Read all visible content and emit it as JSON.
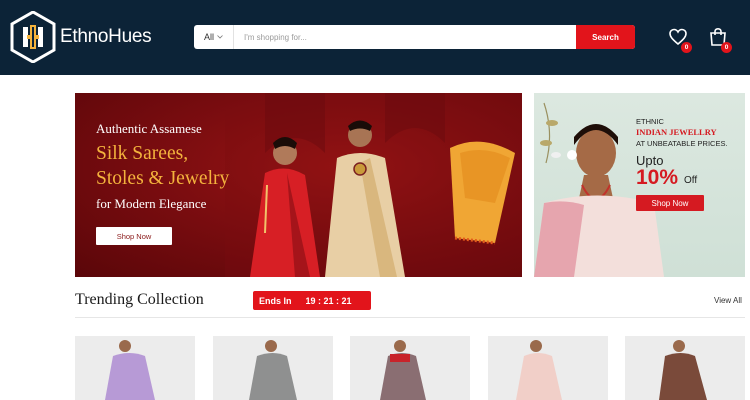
{
  "header": {
    "brand": "EthnoHues",
    "search": {
      "category": "All",
      "placeholder": "I'm shopping for...",
      "button_label": "Search"
    },
    "wishlist_count": "0",
    "cart_count": "0"
  },
  "hero": {
    "line1": "Authentic Assamese",
    "line2a": "Silk Sarees,",
    "line2b": "Stoles & Jewelry",
    "line3": "for Modern Elegance",
    "button_label": "Shop Now"
  },
  "side_banner": {
    "line1": "ETHNIC",
    "line2": "INDIAN JEWELLRY",
    "line3": "AT UNBEATABLE PRICES.",
    "line4": "Upto",
    "discount": "10%",
    "off": "Off",
    "button_label": "Shop Now"
  },
  "trending": {
    "title": "Trending Collection",
    "ends_in_label": "Ends In",
    "timer": "19 : 21 : 21",
    "view_all": "View All"
  },
  "products": [
    {
      "saree_color": "#b79ad6"
    },
    {
      "saree_color": "#8f9090"
    },
    {
      "saree_color": "#8a6e72"
    },
    {
      "saree_color": "#f1cfc8"
    },
    {
      "saree_color": "#7a4a3a"
    }
  ],
  "colors": {
    "header_bg": "#0c2337",
    "accent_red": "#e2141b",
    "gold": "#f4b33d"
  }
}
